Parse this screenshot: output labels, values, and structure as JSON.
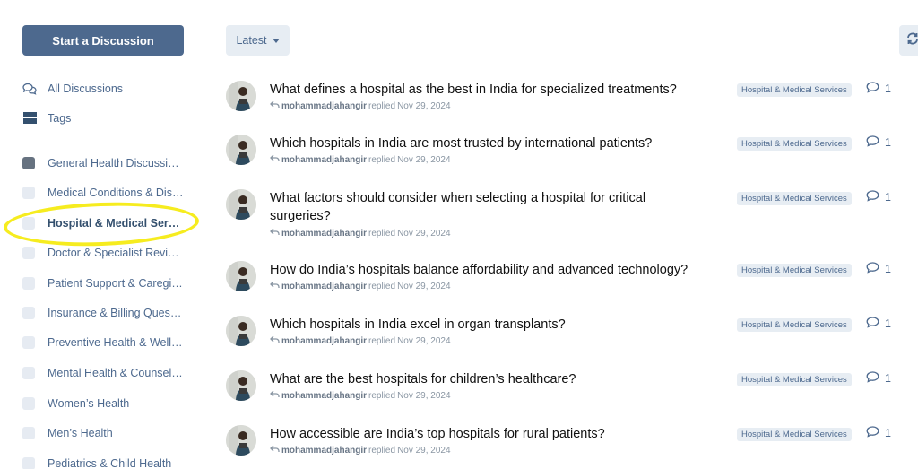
{
  "sidebar": {
    "start_label": "Start a Discussion",
    "items": [
      {
        "label": "All Discussions",
        "icon": "comments-icon"
      },
      {
        "label": "Tags",
        "icon": "tags-grid-icon"
      },
      {
        "label": "General Health Discussions",
        "color": "#667280"
      },
      {
        "label": "Medical Conditions & Diseases",
        "color": "#e6ebf2"
      },
      {
        "label": "Hospital & Medical Services",
        "color": "#e6ebf2",
        "active": true
      },
      {
        "label": "Doctor & Specialist Reviews",
        "color": "#e6ebf2"
      },
      {
        "label": "Patient Support & Caregivers",
        "color": "#e6ebf2"
      },
      {
        "label": "Insurance & Billing Questions",
        "color": "#e6ebf2"
      },
      {
        "label": "Preventive Health & Wellness",
        "color": "#e6ebf2"
      },
      {
        "label": "Mental Health & Counseling",
        "color": "#e6ebf2"
      },
      {
        "label": "Women’s Health",
        "color": "#e6ebf2"
      },
      {
        "label": "Men’s Health",
        "color": "#e6ebf2"
      },
      {
        "label": "Pediatrics & Child Health",
        "color": "#e6ebf2"
      }
    ]
  },
  "toolbar": {
    "sort_label": "Latest",
    "refresh_icon": "refresh-icon"
  },
  "discussions": [
    {
      "title": "What defines a hospital as the best in India for specialized treatments?",
      "user": "mohammadjahangir",
      "action": "replied",
      "date": "Nov 29, 2024",
      "tag": "Hospital & Medical Services",
      "replies": "1"
    },
    {
      "title": "Which hospitals in India are most trusted by international patients?",
      "user": "mohammadjahangir",
      "action": "replied",
      "date": "Nov 29, 2024",
      "tag": "Hospital & Medical Services",
      "replies": "1"
    },
    {
      "title": "What factors should consider when selecting a hospital for critical surgeries?",
      "user": "mohammadjahangir",
      "action": "replied",
      "date": "Nov 29, 2024",
      "tag": "Hospital & Medical Services",
      "replies": "1"
    },
    {
      "title": "How do India’s hospitals balance affordability and advanced technology?",
      "user": "mohammadjahangir",
      "action": "replied",
      "date": "Nov 29, 2024",
      "tag": "Hospital & Medical Services",
      "replies": "1"
    },
    {
      "title": "Which hospitals in India excel in organ transplants?",
      "user": "mohammadjahangir",
      "action": "replied",
      "date": "Nov 29, 2024",
      "tag": "Hospital & Medical Services",
      "replies": "1"
    },
    {
      "title": "What are the best hospitals for children’s healthcare?",
      "user": "mohammadjahangir",
      "action": "replied",
      "date": "Nov 29, 2024",
      "tag": "Hospital & Medical Services",
      "replies": "1"
    },
    {
      "title": "How accessible are India’s top hospitals for rural patients?",
      "user": "mohammadjahangir",
      "action": "replied",
      "date": "Nov 29, 2024",
      "tag": "Hospital & Medical Services",
      "replies": "1"
    }
  ],
  "colors": {
    "accent": "#4d698e",
    "tag_bg": "#e7edf3",
    "highlight": "#f6ec1f"
  }
}
